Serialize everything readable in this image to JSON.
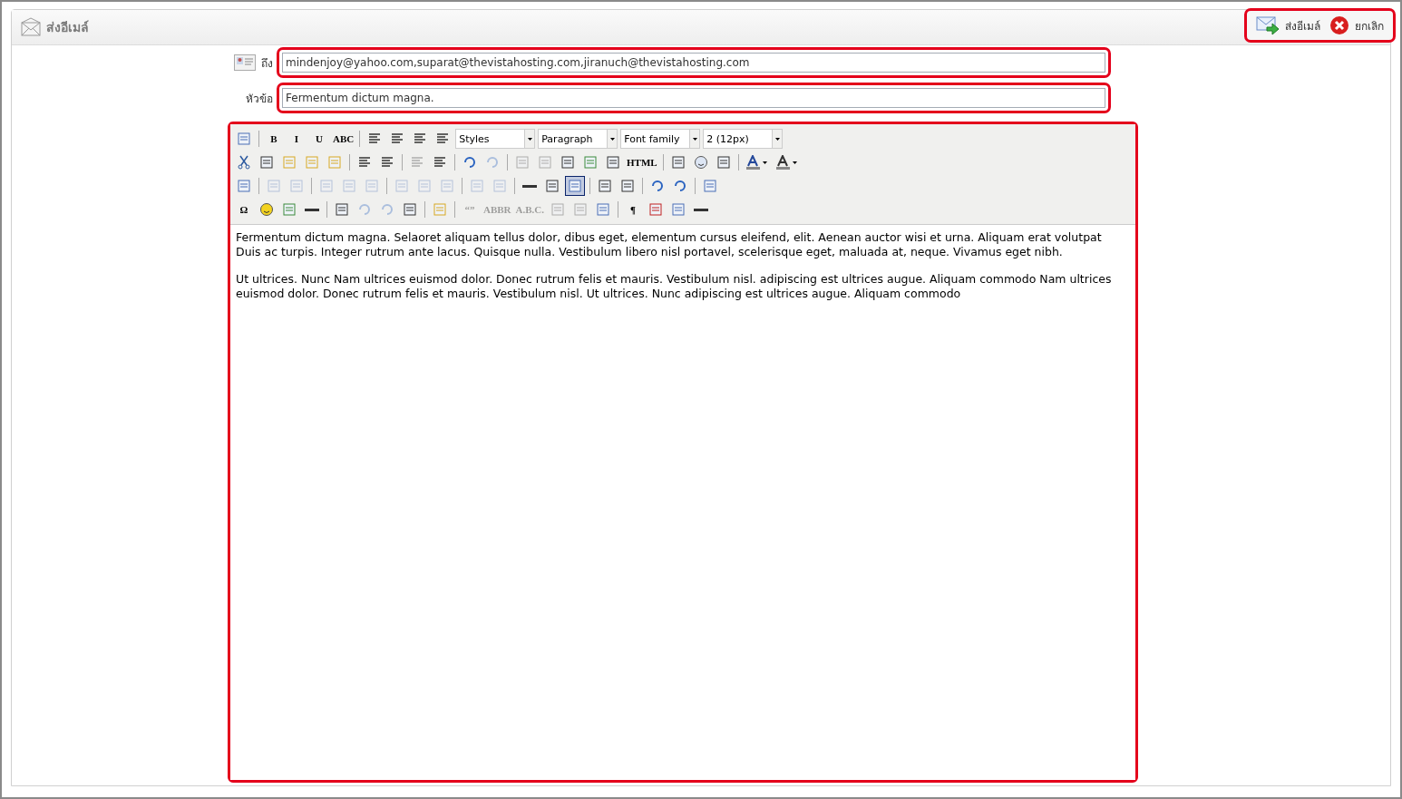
{
  "header": {
    "title": "ส่งอีเมล์",
    "actions": [
      {
        "kind": "send",
        "label": "ส่งอีเมล์"
      },
      {
        "kind": "cancel",
        "label": "ยกเลิก"
      }
    ]
  },
  "form": {
    "to": {
      "label": "ถึง",
      "value": "mindenjoy@yahoo.com,suparat@thevistahosting.com,jiranuch@thevistahosting.com"
    },
    "subject": {
      "label": "หัวข้อ",
      "value": "Fermentum dictum magna."
    }
  },
  "toolbar": {
    "rows": [
      {
        "items": [
          {
            "kind": "icon",
            "disabled": false,
            "active": false
          },
          {
            "kind": "separator"
          },
          {
            "kind": "glyph",
            "label": "B",
            "disabled": false,
            "active": false
          },
          {
            "kind": "glyph",
            "label": "I",
            "disabled": false,
            "active": false
          },
          {
            "kind": "glyph",
            "label": "U",
            "disabled": false,
            "active": false
          },
          {
            "kind": "glyph",
            "label": "ABC",
            "disabled": false,
            "active": false
          },
          {
            "kind": "separator"
          },
          {
            "kind": "icon",
            "disabled": false,
            "active": false
          },
          {
            "kind": "icon",
            "disabled": false,
            "active": false
          },
          {
            "kind": "icon",
            "disabled": false,
            "active": false
          },
          {
            "kind": "icon",
            "disabled": false,
            "active": false
          },
          {
            "kind": "select",
            "value": "Styles"
          },
          {
            "kind": "select",
            "value": "Paragraph"
          },
          {
            "kind": "select",
            "value": "Font family"
          },
          {
            "kind": "select",
            "value": "2 (12px)"
          }
        ]
      },
      {
        "items": [
          {
            "kind": "icon",
            "disabled": false,
            "active": false
          },
          {
            "kind": "icon",
            "disabled": false,
            "active": false
          },
          {
            "kind": "icon",
            "disabled": false,
            "active": false
          },
          {
            "kind": "icon",
            "disabled": false,
            "active": false
          },
          {
            "kind": "icon",
            "disabled": false,
            "active": false
          },
          {
            "kind": "separator"
          },
          {
            "kind": "icon",
            "disabled": false,
            "active": false
          },
          {
            "kind": "icon",
            "disabled": false,
            "active": false
          },
          {
            "kind": "separator"
          },
          {
            "kind": "icon",
            "disabled": true,
            "active": false
          },
          {
            "kind": "icon",
            "disabled": false,
            "active": false
          },
          {
            "kind": "separator"
          },
          {
            "kind": "icon",
            "disabled": false,
            "active": false
          },
          {
            "kind": "icon",
            "disabled": true,
            "active": false
          },
          {
            "kind": "separator"
          },
          {
            "kind": "icon",
            "disabled": true,
            "active": false
          },
          {
            "kind": "icon",
            "disabled": true,
            "active": false
          },
          {
            "kind": "icon",
            "disabled": false,
            "active": false
          },
          {
            "kind": "icon",
            "disabled": false,
            "active": false
          },
          {
            "kind": "icon",
            "disabled": false,
            "active": false
          },
          {
            "kind": "glyph",
            "label": "HTML",
            "disabled": false,
            "active": false
          },
          {
            "kind": "separator"
          },
          {
            "kind": "icon",
            "disabled": false,
            "active": false
          },
          {
            "kind": "icon",
            "disabled": false,
            "active": false
          },
          {
            "kind": "icon",
            "disabled": false,
            "active": false
          },
          {
            "kind": "separator"
          },
          {
            "kind": "color",
            "disabled": false,
            "active": false
          },
          {
            "kind": "color",
            "disabled": false,
            "active": false
          }
        ]
      },
      {
        "items": [
          {
            "kind": "icon",
            "disabled": false,
            "active": false
          },
          {
            "kind": "separator"
          },
          {
            "kind": "icon",
            "disabled": true,
            "active": false
          },
          {
            "kind": "icon",
            "disabled": true,
            "active": false
          },
          {
            "kind": "separator"
          },
          {
            "kind": "icon",
            "disabled": true,
            "active": false
          },
          {
            "kind": "icon",
            "disabled": true,
            "active": false
          },
          {
            "kind": "icon",
            "disabled": true,
            "active": false
          },
          {
            "kind": "separator"
          },
          {
            "kind": "icon",
            "disabled": true,
            "active": false
          },
          {
            "kind": "icon",
            "disabled": true,
            "active": false
          },
          {
            "kind": "icon",
            "disabled": true,
            "active": false
          },
          {
            "kind": "separator"
          },
          {
            "kind": "icon",
            "disabled": true,
            "active": false
          },
          {
            "kind": "icon",
            "disabled": true,
            "active": false
          },
          {
            "kind": "separator"
          },
          {
            "kind": "icon",
            "disabled": false,
            "active": false
          },
          {
            "kind": "icon",
            "disabled": false,
            "active": false
          },
          {
            "kind": "icon",
            "disabled": false,
            "active": true
          },
          {
            "kind": "separator"
          },
          {
            "kind": "icon",
            "disabled": false,
            "active": false
          },
          {
            "kind": "icon",
            "disabled": false,
            "active": false
          },
          {
            "kind": "separator"
          },
          {
            "kind": "icon",
            "disabled": false,
            "active": false
          },
          {
            "kind": "icon",
            "disabled": false,
            "active": false
          },
          {
            "kind": "separator"
          },
          {
            "kind": "icon",
            "disabled": false,
            "active": false
          }
        ]
      },
      {
        "items": [
          {
            "kind": "glyph",
            "label": "Ω",
            "disabled": false,
            "active": false
          },
          {
            "kind": "icon",
            "disabled": false,
            "active": false
          },
          {
            "kind": "icon",
            "disabled": false,
            "active": false
          },
          {
            "kind": "icon",
            "disabled": false,
            "active": false
          },
          {
            "kind": "separator"
          },
          {
            "kind": "icon",
            "disabled": false,
            "active": false
          },
          {
            "kind": "icon",
            "disabled": true,
            "active": false
          },
          {
            "kind": "icon",
            "disabled": true,
            "active": false
          },
          {
            "kind": "icon",
            "disabled": false,
            "active": false
          },
          {
            "kind": "separator"
          },
          {
            "kind": "icon",
            "disabled": false,
            "active": false
          },
          {
            "kind": "separator"
          },
          {
            "kind": "glyph",
            "label": "“”",
            "disabled": true,
            "active": false
          },
          {
            "kind": "glyph",
            "label": "ABBR",
            "disabled": true,
            "active": false
          },
          {
            "kind": "glyph",
            "label": "A.B.C.",
            "disabled": true,
            "active": false
          },
          {
            "kind": "icon",
            "disabled": true,
            "active": false
          },
          {
            "kind": "icon",
            "disabled": true,
            "active": false
          },
          {
            "kind": "icon",
            "disabled": false,
            "active": false
          },
          {
            "kind": "separator"
          },
          {
            "kind": "glyph",
            "label": "¶",
            "disabled": false,
            "active": false
          },
          {
            "kind": "icon",
            "disabled": false,
            "active": false
          },
          {
            "kind": "icon",
            "disabled": false,
            "active": false
          },
          {
            "kind": "icon",
            "disabled": false,
            "active": false
          }
        ]
      }
    ]
  },
  "body": {
    "paragraphs": [
      "Fermentum dictum magna. Selaoret aliquam tellus dolor, dibus eget, elementum cursus eleifend, elit. Aenean auctor wisi et urna. Aliquam erat volutpat Duis ac turpis. Integer rutrum ante lacus. Quisque nulla. Vestibulum libero nisl portavel, scelerisque eget, maluada at, neque. Vivamus eget nibh.",
      "Ut ultrices. Nunc Nam ultrices euismod dolor. Donec rutrum felis et mauris. Vestibulum nisl. adipiscing est ultrices augue. Aliquam commodo Nam ultrices euismod dolor. Donec rutrum felis et mauris. Vestibulum nisl. Ut ultrices. Nunc adipiscing est ultrices augue. Aliquam commodo"
    ]
  }
}
